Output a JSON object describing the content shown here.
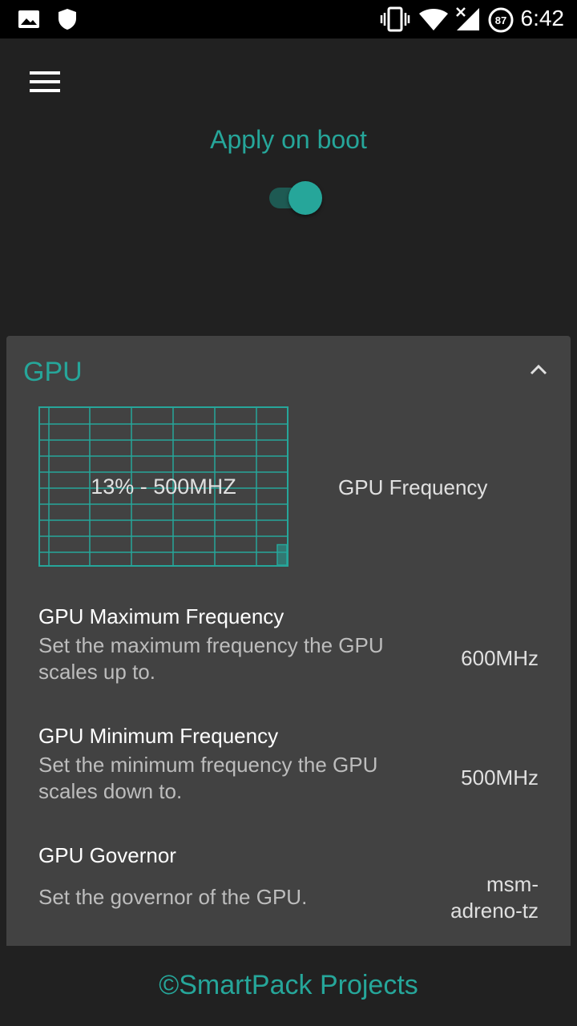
{
  "status_bar": {
    "time": "6:42",
    "battery_level": "87",
    "icons": [
      "image-icon",
      "shield-icon",
      "vibrate-icon",
      "wifi-icon",
      "no-signal-icon",
      "battery-icon"
    ]
  },
  "toolbar": {
    "menu_icon": "hamburger-menu-icon",
    "apply_on_boot_label": "Apply on boot",
    "apply_on_boot_enabled": true
  },
  "gpu_card": {
    "title": "GPU",
    "collapse_icon": "chevron-up-icon",
    "frequency_graph": {
      "current_text": "13% - 500MHZ",
      "usage_percent": 13,
      "caption": "GPU Frequency"
    },
    "items": [
      {
        "title": "GPU Maximum Frequency",
        "summary": "Set the maximum frequency the GPU scales up to.",
        "value": "600MHz"
      },
      {
        "title": "GPU Minimum Frequency",
        "summary": "Set the minimum frequency the GPU scales down to.",
        "value": "500MHz"
      },
      {
        "title": "GPU Governor",
        "summary": "Set the governor of the GPU.",
        "value": "msm-adreno-tz"
      }
    ]
  },
  "footer": {
    "text": "©SmartPack Projects"
  },
  "colors": {
    "accent": "#26a69a",
    "background": "#212121",
    "card": "#424242"
  }
}
